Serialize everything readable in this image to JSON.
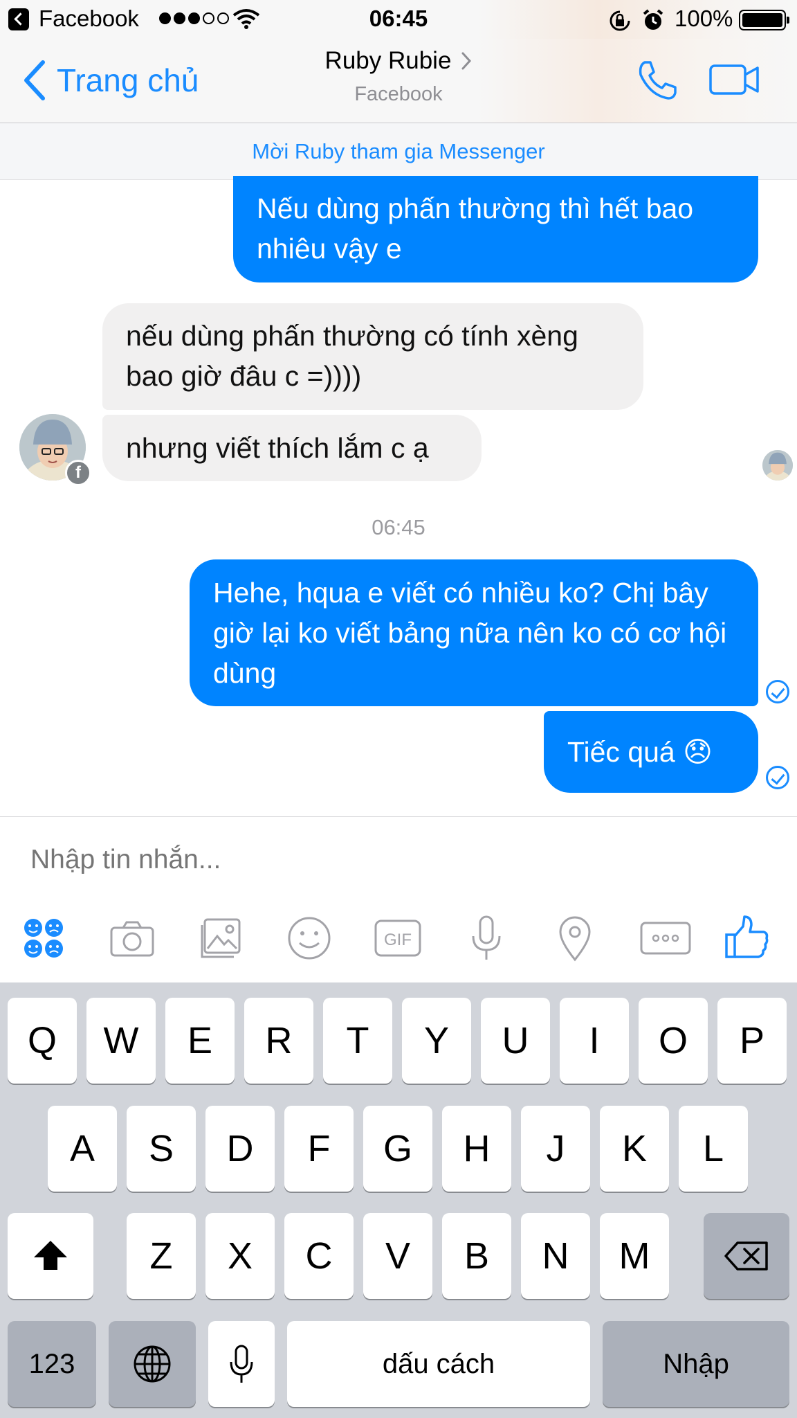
{
  "status_bar": {
    "app": "Facebook",
    "time": "06:45",
    "battery": "100%",
    "signal_dots_filled": 3,
    "signal_dots_total": 5
  },
  "nav": {
    "back_label": "Trang chủ",
    "contact_name": "Ruby Rubie",
    "subtitle": "Facebook"
  },
  "invite_banner": "Mời Ruby tham gia Messenger",
  "messages": [
    {
      "from": "me",
      "text": "Nếu dùng phấn thường thì hết bao nhiêu vậy e"
    },
    {
      "from": "them",
      "text": "nếu dùng phấn thường có tính xèng bao giờ đâu c =))))"
    },
    {
      "from": "them",
      "text": "nhưng viết thích lắm c ạ"
    },
    {
      "from": "me",
      "text": "Hehe, hqua e viết có nhiều ko? Chị bây giờ lại ko viết bảng nữa nên ko có cơ hội dùng"
    },
    {
      "from": "me",
      "text": "Tiếc quá 😞"
    }
  ],
  "timestamp": "06:45",
  "composer": {
    "placeholder": "Nhập tin nhắn..."
  },
  "toolbar_icons": [
    "stickers-icon",
    "camera-icon",
    "gallery-icon",
    "emoji-icon",
    "gif-icon",
    "microphone-icon",
    "location-icon",
    "more-icon",
    "like-icon"
  ],
  "toolbar": {
    "gif": "GIF"
  },
  "keyboard": {
    "row1": [
      "Q",
      "W",
      "E",
      "R",
      "T",
      "Y",
      "U",
      "I",
      "O",
      "P"
    ],
    "row2": [
      "A",
      "S",
      "D",
      "F",
      "G",
      "H",
      "J",
      "K",
      "L"
    ],
    "row3": [
      "Z",
      "X",
      "C",
      "V",
      "B",
      "N",
      "M"
    ],
    "numbers": "123",
    "space": "dấu cách",
    "return": "Nhập"
  },
  "colors": {
    "accent": "#0084ff",
    "link": "#1a8cff",
    "incoming_bubble": "#f1f0f0",
    "keyboard_bg": "#d1d4da"
  }
}
